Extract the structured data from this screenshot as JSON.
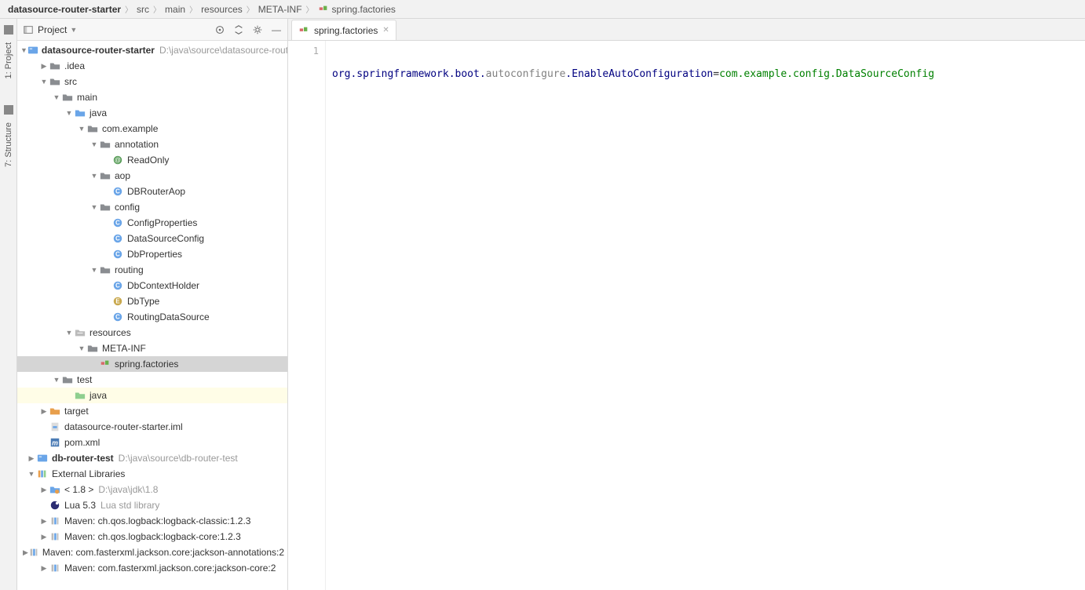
{
  "breadcrumb": {
    "items": [
      {
        "label": "datasource-router-starter",
        "bold": true
      },
      {
        "label": "src"
      },
      {
        "label": "main"
      },
      {
        "label": "resources"
      },
      {
        "label": "META-INF"
      },
      {
        "label": "spring.factories",
        "icon": "factories"
      }
    ]
  },
  "leftRail": {
    "project": "1: Project",
    "structure": "7: Structure"
  },
  "sidebar": {
    "title": "Project"
  },
  "editor": {
    "tab": {
      "label": "spring.factories"
    },
    "gutter": [
      "1"
    ],
    "code": {
      "seg1": "org.springframework.boot.",
      "seg2": "autoconfigure",
      "seg3": ".EnableAutoConfiguration",
      "seg4": "=",
      "seg5": "com.example.config.DataSourceConfig"
    }
  },
  "tree": [
    {
      "d": 0,
      "arrow": "down",
      "icon": "module",
      "label": "datasource-router-starter",
      "bold": true,
      "hint": "D:\\java\\source\\datasource-router-starter"
    },
    {
      "d": 1,
      "arrow": "right",
      "icon": "folder",
      "label": ".idea"
    },
    {
      "d": 1,
      "arrow": "down",
      "icon": "folder",
      "label": "src"
    },
    {
      "d": 2,
      "arrow": "down",
      "icon": "folder",
      "label": "main"
    },
    {
      "d": 3,
      "arrow": "down",
      "icon": "folder-blue",
      "label": "java"
    },
    {
      "d": 4,
      "arrow": "down",
      "icon": "folder",
      "label": "com.example"
    },
    {
      "d": 5,
      "arrow": "down",
      "icon": "folder",
      "label": "annotation"
    },
    {
      "d": 6,
      "arrow": "none",
      "icon": "ann",
      "label": "ReadOnly"
    },
    {
      "d": 5,
      "arrow": "down",
      "icon": "folder",
      "label": "aop"
    },
    {
      "d": 6,
      "arrow": "none",
      "icon": "class-c",
      "label": "DBRouterAop"
    },
    {
      "d": 5,
      "arrow": "down",
      "icon": "folder",
      "label": "config"
    },
    {
      "d": 6,
      "arrow": "none",
      "icon": "class-c",
      "label": "ConfigProperties"
    },
    {
      "d": 6,
      "arrow": "none",
      "icon": "class-c",
      "label": "DataSourceConfig"
    },
    {
      "d": 6,
      "arrow": "none",
      "icon": "class-c",
      "label": "DbProperties"
    },
    {
      "d": 5,
      "arrow": "down",
      "icon": "folder",
      "label": "routing"
    },
    {
      "d": 6,
      "arrow": "none",
      "icon": "class-c",
      "label": "DbContextHolder"
    },
    {
      "d": 6,
      "arrow": "none",
      "icon": "class-e",
      "label": "DbType"
    },
    {
      "d": 6,
      "arrow": "none",
      "icon": "class-c",
      "label": "RoutingDataSource"
    },
    {
      "d": 3,
      "arrow": "down",
      "icon": "folder-res",
      "label": "resources"
    },
    {
      "d": 4,
      "arrow": "down",
      "icon": "folder",
      "label": "META-INF"
    },
    {
      "d": 5,
      "arrow": "none",
      "icon": "factories",
      "label": "spring.factories",
      "selected": true
    },
    {
      "d": 2,
      "arrow": "down",
      "icon": "folder",
      "label": "test"
    },
    {
      "d": 3,
      "arrow": "none",
      "icon": "folder-lib",
      "label": "java",
      "highlighted": true
    },
    {
      "d": 1,
      "arrow": "right",
      "icon": "folder-orange",
      "label": "target"
    },
    {
      "d": 1,
      "arrow": "none",
      "icon": "iml",
      "label": "datasource-router-starter.iml"
    },
    {
      "d": 1,
      "arrow": "none",
      "icon": "maven",
      "label": "pom.xml"
    },
    {
      "d": 0,
      "arrow": "right",
      "icon": "module",
      "label": "db-router-test",
      "bold": true,
      "hint": "D:\\java\\source\\db-router-test"
    },
    {
      "d": 0,
      "arrow": "down",
      "icon": "libs",
      "label": "External Libraries"
    },
    {
      "d": 1,
      "arrow": "right",
      "icon": "sdk",
      "label": "< 1.8 >",
      "hint": "D:\\java\\jdk\\1.8"
    },
    {
      "d": 1,
      "arrow": "none",
      "icon": "lua",
      "label": "Lua 5.3",
      "hint": "Lua std library"
    },
    {
      "d": 1,
      "arrow": "right",
      "icon": "lib",
      "label": "Maven: ch.qos.logback:logback-classic:1.2.3"
    },
    {
      "d": 1,
      "arrow": "right",
      "icon": "lib",
      "label": "Maven: ch.qos.logback:logback-core:1.2.3"
    },
    {
      "d": 1,
      "arrow": "right",
      "icon": "lib",
      "label": "Maven: com.fasterxml.jackson.core:jackson-annotations:2"
    },
    {
      "d": 1,
      "arrow": "right",
      "icon": "lib",
      "label": "Maven: com.fasterxml.jackson.core:jackson-core:2"
    }
  ]
}
